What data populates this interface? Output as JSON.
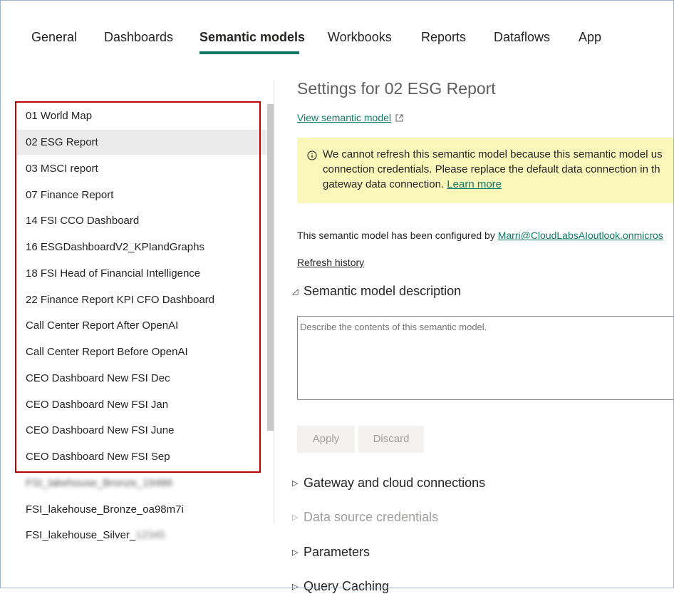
{
  "tabs": [
    "General",
    "Dashboards",
    "Semantic models",
    "Workbooks",
    "Reports",
    "Dataflows",
    "App"
  ],
  "active_tab": "Semantic models",
  "sidebar": {
    "items": [
      {
        "label": "01 World Map"
      },
      {
        "label": "02 ESG Report",
        "selected": true
      },
      {
        "label": "03 MSCI report"
      },
      {
        "label": "07 Finance Report"
      },
      {
        "label": "14 FSI CCO Dashboard"
      },
      {
        "label": "16 ESGDashboardV2_KPIandGraphs"
      },
      {
        "label": "18 FSI Head of Financial Intelligence"
      },
      {
        "label": "22 Finance Report KPI CFO Dashboard"
      },
      {
        "label": "Call Center Report After OpenAI"
      },
      {
        "label": "Call Center Report Before OpenAI"
      },
      {
        "label": "CEO Dashboard New FSI Dec"
      },
      {
        "label": "CEO Dashboard New FSI Jan"
      },
      {
        "label": "CEO Dashboard New FSI June"
      },
      {
        "label": "CEO Dashboard New FSI Sep"
      },
      {
        "label": "FSI_lakehouse_Bronze_19486",
        "blurred": true
      },
      {
        "label": "FSI_lakehouse_Bronze_oa98m7i"
      },
      {
        "label": "FSI_lakehouse_Silver_",
        "suffix_blurred": "12345"
      }
    ]
  },
  "main": {
    "title": "Settings for 02 ESG Report",
    "view_link": "View semantic model",
    "warning": {
      "line1": "We cannot refresh this semantic model because this semantic model us",
      "line2": "connection credentials. Please replace the default data connection in th",
      "line3": "gateway data connection.",
      "learn_more": "Learn more"
    },
    "configured_prefix": "This semantic model has been configured by",
    "configured_email": "Marri@CloudLabsAIoutlook.onmicros",
    "refresh_history": "Refresh history",
    "description_heading": "Semantic model description",
    "description_placeholder": "Describe the contents of this semantic model.",
    "apply": "Apply",
    "discard": "Discard",
    "gateway": "Gateway and cloud connections",
    "data_source": "Data source credentials",
    "parameters": "Parameters",
    "query_caching": "Query Caching"
  },
  "colors": {
    "accent": "#117865",
    "warning_bg": "#fbf6b9",
    "highlight_border": "#c00000",
    "selected_bg": "#ebebeb"
  }
}
